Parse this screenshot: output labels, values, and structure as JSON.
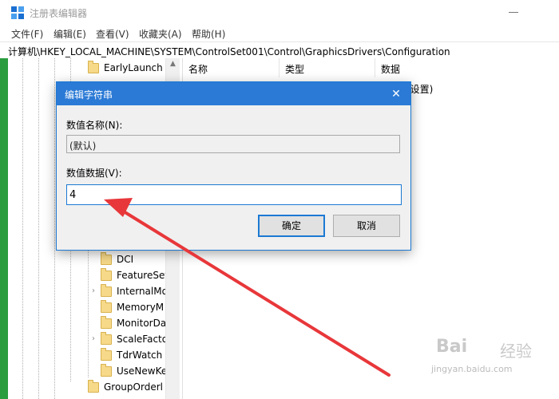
{
  "window": {
    "title": "注册表编辑器"
  },
  "menu": {
    "items": [
      "文件(F)",
      "编辑(E)",
      "查看(V)",
      "收藏夹(A)",
      "帮助(H)"
    ]
  },
  "address": {
    "path": "计算机\\HKEY_LOCAL_MACHINE\\SYSTEM\\ControlSet001\\Control\\GraphicsDrivers\\Configuration"
  },
  "tree": {
    "nodes": [
      {
        "label": "EarlyLaunch"
      },
      {
        "label": "DCI"
      },
      {
        "label": "FeatureSet"
      },
      {
        "label": "InternalMo"
      },
      {
        "label": "MemoryM"
      },
      {
        "label": "MonitorDa"
      },
      {
        "label": "ScaleFacto"
      },
      {
        "label": "TdrWatch"
      },
      {
        "label": "UseNewKe"
      },
      {
        "label": "GroupOrderl"
      }
    ],
    "expander_glyph": "›"
  },
  "values": {
    "columns": [
      "名称",
      "类型",
      "数据"
    ],
    "row_data_fragment": "(设置)"
  },
  "dialog": {
    "title": "编辑字符串",
    "name_label": "数值名称(N):",
    "name_value": "(默认)",
    "data_label": "数值数据(V):",
    "data_value": "4",
    "ok_label": "确定",
    "cancel_label": "取消",
    "close_glyph": "✕"
  },
  "watermark": {
    "logo": "Bai",
    "brand": "经验",
    "url": "jingyan.baidu.com"
  },
  "colors": {
    "accent": "#2b7ad6",
    "arrow": "#e8373a",
    "tree_border": "#2a9d3f"
  }
}
